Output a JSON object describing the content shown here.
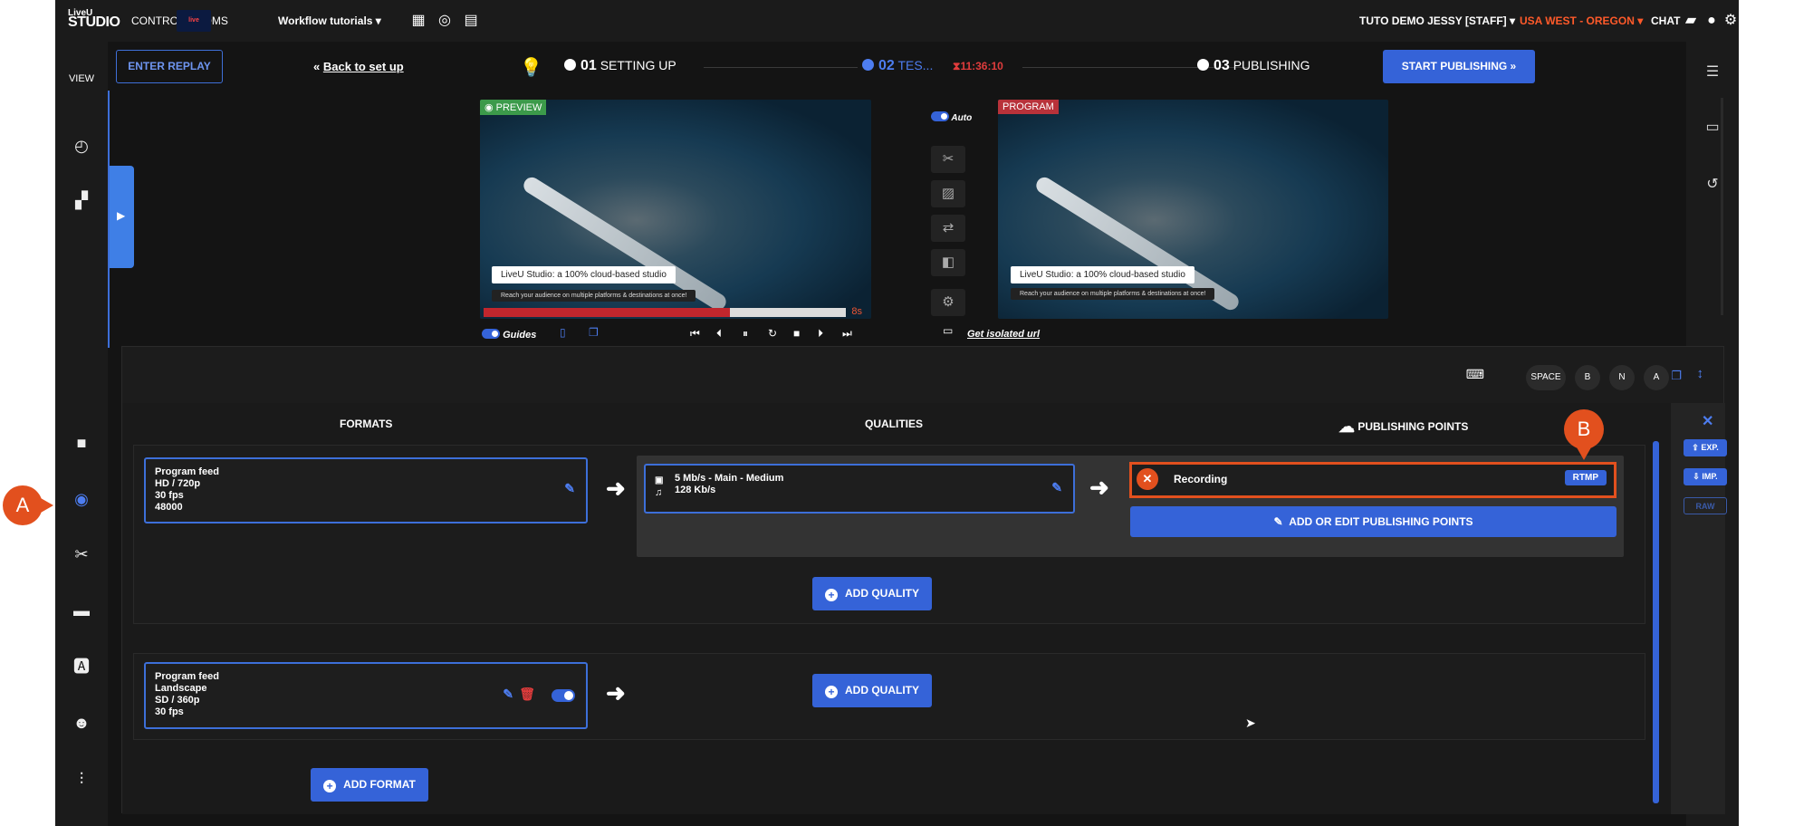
{
  "topbar": {
    "logo_top": "LiveU",
    "logo_bottom": "STUDIO",
    "control_rooms": "CONTROL ROOMS",
    "thumb_label": "live",
    "workflow": "Workflow tutorials",
    "user": "TUTO DEMO JESSY [STAFF]",
    "region": "USA WEST - OREGON",
    "chat": "CHAT"
  },
  "sidebar": {
    "view": "VIEW"
  },
  "stepbar": {
    "enter_replay": "ENTER REPLAY",
    "back": "Back to set up",
    "step1_num": "01",
    "step1_label": "SETTING UP",
    "step2_num": "02",
    "step2_label": "TES...",
    "timer": "11:36:10",
    "step3_num": "03",
    "step3_label": "PUBLISHING",
    "start_publishing": "START PUBLISHING"
  },
  "preview": {
    "tag": "PREVIEW",
    "lower_third": "LiveU Studio: a 100% cloud-based studio",
    "lower_sub": "Reach your audience on multiple platforms & destinations at once!",
    "remaining": "8s",
    "progress": 0.68
  },
  "program": {
    "tag": "PROGRAM",
    "lower_third": "LiveU Studio: a 100% cloud-based studio",
    "lower_sub": "Reach your audience on multiple platforms & destinations at once!"
  },
  "mid": {
    "auto_label": "Auto"
  },
  "under": {
    "guides": "Guides",
    "isolated": "Get isolated url"
  },
  "shortcuts": [
    "SPACE",
    "B",
    "N",
    "A"
  ],
  "publishing": {
    "formats_header": "FORMATS",
    "qualities_header": "QUALITIES",
    "points_header": "PUBLISHING POINTS",
    "format1": {
      "line1": "Program feed",
      "line2": "HD / 720p",
      "line3": "30 fps",
      "line4": "48000"
    },
    "quality1": {
      "line1": "5 Mb/s  -  Main  -  Medium",
      "line2": "128 Kb/s"
    },
    "point1": {
      "name": "Recording",
      "protocol": "RTMP"
    },
    "add_edit_points": "ADD OR EDIT PUBLISHING POINTS",
    "add_quality": "ADD QUALITY",
    "format2": {
      "line1": "Program feed",
      "line2": "Landscape",
      "line3": "SD / 360p",
      "line4": "30 fps"
    },
    "add_format": "ADD FORMAT",
    "exp": "EXP.",
    "imp": "IMP.",
    "raw": "RAW"
  },
  "callouts": {
    "a": "A",
    "b": "B"
  },
  "colors": {
    "accent": "#3563d8",
    "highlight": "#e2501e",
    "region": "#ff5a2a"
  }
}
